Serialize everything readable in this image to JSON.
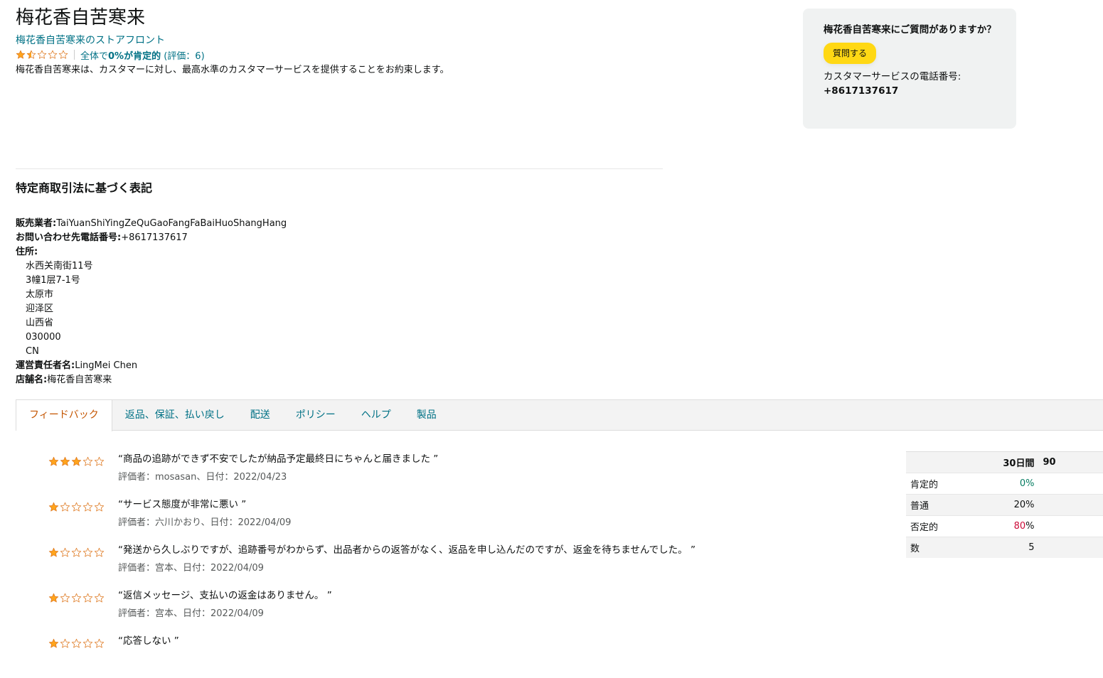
{
  "header": {
    "title": "梅花香自苦寒来",
    "storefront_link": "梅花香自苦寒来のストアフロント",
    "rating_stars": 1.5,
    "rating_summary_prefix": "全体で",
    "rating_summary_bold": "0%が肯定的",
    "rating_count": "(評価：6)",
    "promise": "梅花香自苦寒来は、カスタマーに対し、最高水準のカスタマーサービスを提供することをお約束します。"
  },
  "question_box": {
    "title": "梅花香自苦寒来にご質問がありますか？",
    "ask_button": "質問する",
    "cs_label": "カスタマーサービスの電話番号:",
    "cs_phone": "+8617137617"
  },
  "legal": {
    "title": "特定商取引法に基づく表記",
    "seller_label": "販売業者:",
    "seller_value": "TaiYuanShiYingZeQuGaoFangFaBaiHuoShangHang",
    "phone_label": "お問い合わせ先電話番号:",
    "phone_value": "+8617137617",
    "address_label": "住所:",
    "address_lines": [
      "水西关南街11号",
      "3幢1层7-1号",
      "太原市",
      "迎泽区",
      "山西省",
      "030000",
      "CN"
    ],
    "manager_label": "運営責任者名:",
    "manager_value": "LingMei Chen",
    "store_label": "店舗名:",
    "store_value": "梅花香自苦寒来"
  },
  "tabs": [
    {
      "label": "フィードバック",
      "active": true
    },
    {
      "label": "返品、保証、払い戻し",
      "active": false
    },
    {
      "label": "配送",
      "active": false
    },
    {
      "label": "ポリシー",
      "active": false
    },
    {
      "label": "ヘルプ",
      "active": false
    },
    {
      "label": "製品",
      "active": false
    }
  ],
  "feedback": [
    {
      "stars": 3,
      "comment": "“商品の追跡ができず不安でしたが納品予定最終日にちゃんと届きました ”",
      "byline": "評価者：mosasan、日付：2022/04/23"
    },
    {
      "stars": 1,
      "comment": "“サービス態度が非常に悪い ”",
      "byline": "評価者：六川かおり、日付：2022/04/09"
    },
    {
      "stars": 1,
      "comment": "“発送から久しぶりですが、追跡番号がわからず、出品者からの返答がなく、返品を申し込んだのですが、返金を待ちませんでした。 ”",
      "byline": "評価者：宫本、日付：2022/04/09"
    },
    {
      "stars": 1,
      "comment": "“返信メッセージ、支払いの返金はありません。 ”",
      "byline": "評価者：宫本、日付：2022/04/09"
    },
    {
      "stars": 1,
      "comment": "“応答しない ”",
      "byline": ""
    }
  ],
  "stats": {
    "headers": [
      "30日間",
      "90"
    ],
    "rows": [
      {
        "label": "肯定的",
        "value": "0%"
      },
      {
        "label": "普通",
        "value": "20%"
      },
      {
        "label": "否定的",
        "value_num": "80",
        "value_unit": "%"
      },
      {
        "label": "数",
        "value": "5"
      }
    ]
  },
  "colors": {
    "link": "#007185",
    "active_tab": "#c45500",
    "star": "#ffa41c",
    "ask_button": "#ffd814",
    "negative": "#cc0c39",
    "positive": "#067d62"
  }
}
